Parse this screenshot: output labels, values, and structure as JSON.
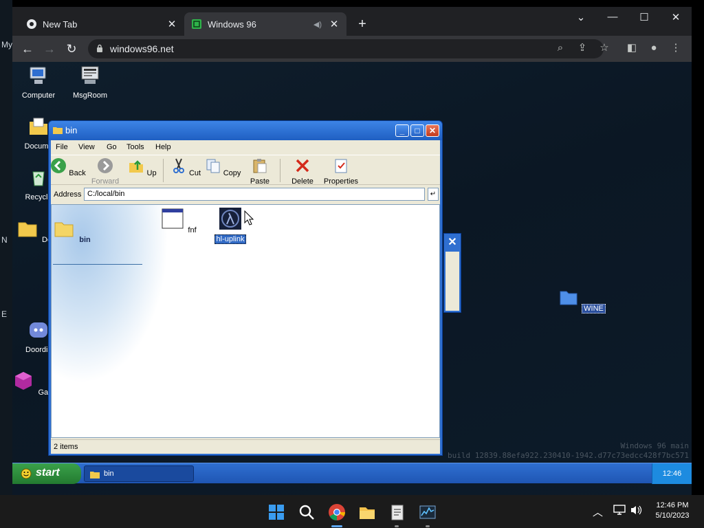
{
  "host": {
    "edge_labels": [
      "My",
      "N",
      "E"
    ],
    "taskbar": {
      "icons": [
        "windows-start-icon",
        "search-icon",
        "chrome-icon",
        "file-explorer-icon",
        "notepad-icon",
        "task-manager-icon"
      ],
      "time": "12:46 PM",
      "date": "5/10/2023"
    }
  },
  "browser": {
    "tabs": [
      {
        "title": "New Tab",
        "active": false
      },
      {
        "title": "Windows 96",
        "active": true
      }
    ],
    "new_tab_label": "+",
    "url": "windows96.net",
    "window_controls": {
      "dropdown": "⌄",
      "minimize": "—",
      "maximize": "☐",
      "close": "✕"
    }
  },
  "desktop": {
    "icons": [
      {
        "label": "Computer"
      },
      {
        "label": "MsgRoom"
      },
      {
        "label": "Docume"
      },
      {
        "label": "Recycle"
      },
      {
        "label": "Docs"
      },
      {
        "label": "Doordis"
      },
      {
        "label": "Gameir"
      },
      {
        "label": "WINE"
      }
    ]
  },
  "explorer": {
    "title": "bin",
    "menu": [
      "File",
      "View",
      "Go",
      "Tools",
      "Help"
    ],
    "toolbar": {
      "back": "Back",
      "forward": "Forward",
      "up": "Up",
      "cut": "Cut",
      "copy": "Copy",
      "paste": "Paste",
      "delete": "Delete",
      "properties": "Properties"
    },
    "address_label": "Address",
    "address_value": "C:/local/bin",
    "folder_label": "bin",
    "files": [
      {
        "name": "fnf",
        "selected": false
      },
      {
        "name": "hl-uplink",
        "selected": true
      }
    ],
    "status": "2 items"
  },
  "build_info": {
    "line1": "Windows 96 main",
    "line2": "build 12839.88efa922.230410-1942.d77c73edcc428f7bc571"
  },
  "w96_taskbar": {
    "start_label": "start",
    "task_item": "bin",
    "clock": "12:46"
  },
  "colors": {
    "xp_blue": "#2f6fd0",
    "start_green": "#3aa14a",
    "selection": "#316ac5"
  }
}
